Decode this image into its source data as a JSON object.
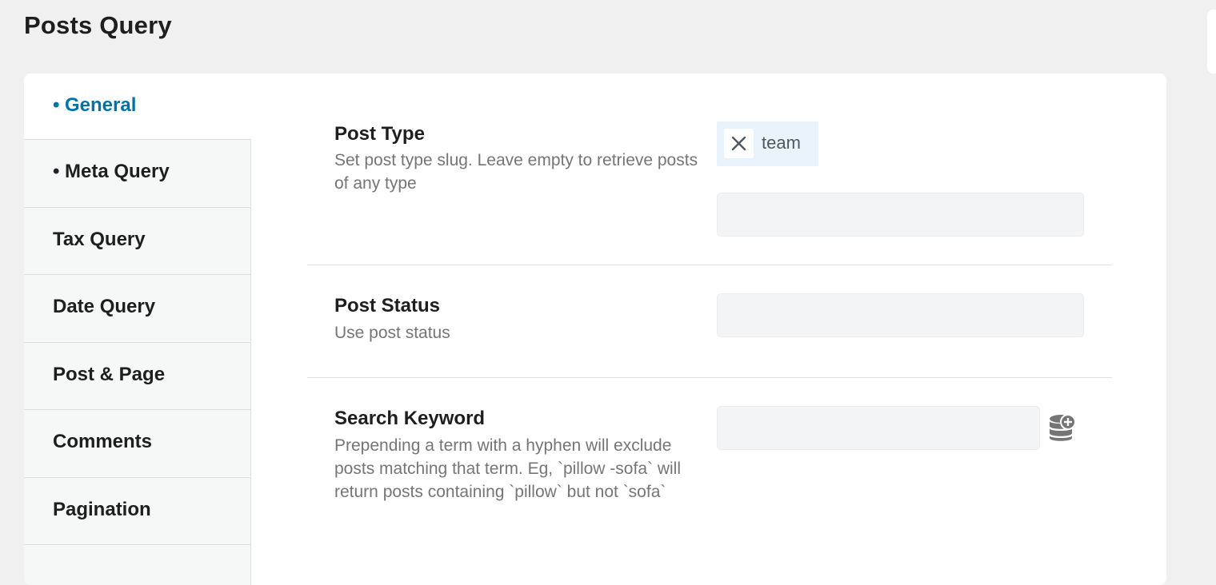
{
  "page": {
    "title": "Posts Query"
  },
  "tabs": [
    {
      "label": "General",
      "dot": "•",
      "active": true
    },
    {
      "label": "Meta Query",
      "dot": "•",
      "active": false
    },
    {
      "label": "Tax Query",
      "dot": "",
      "active": false
    },
    {
      "label": "Date Query",
      "dot": "",
      "active": false
    },
    {
      "label": "Post & Page",
      "dot": "",
      "active": false
    },
    {
      "label": "Comments",
      "dot": "",
      "active": false
    },
    {
      "label": "Pagination",
      "dot": "",
      "active": false
    }
  ],
  "fields": {
    "post_type": {
      "label": "Post Type",
      "description": "Set post type slug. Leave empty to retrieve posts of any type",
      "chips": [
        "team"
      ],
      "input_value": ""
    },
    "post_status": {
      "label": "Post Status",
      "description": "Use post status",
      "input_value": ""
    },
    "search_keyword": {
      "label": "Search Keyword",
      "description": "Prepending a term with a hyphen will exclude posts matching that term. Eg, `pillow -sofa` will return posts containing `pillow` but not `sofa`",
      "input_value": ""
    }
  },
  "icons": {
    "chip_remove": "close-icon",
    "dynamic_tags": "database-add-icon"
  },
  "colors": {
    "accent": "#0073aa",
    "chip_bg": "#eaf3fb",
    "field_bg": "#f3f4f5",
    "page_bg": "#f0f0f1",
    "icon_gray": "#757575"
  }
}
